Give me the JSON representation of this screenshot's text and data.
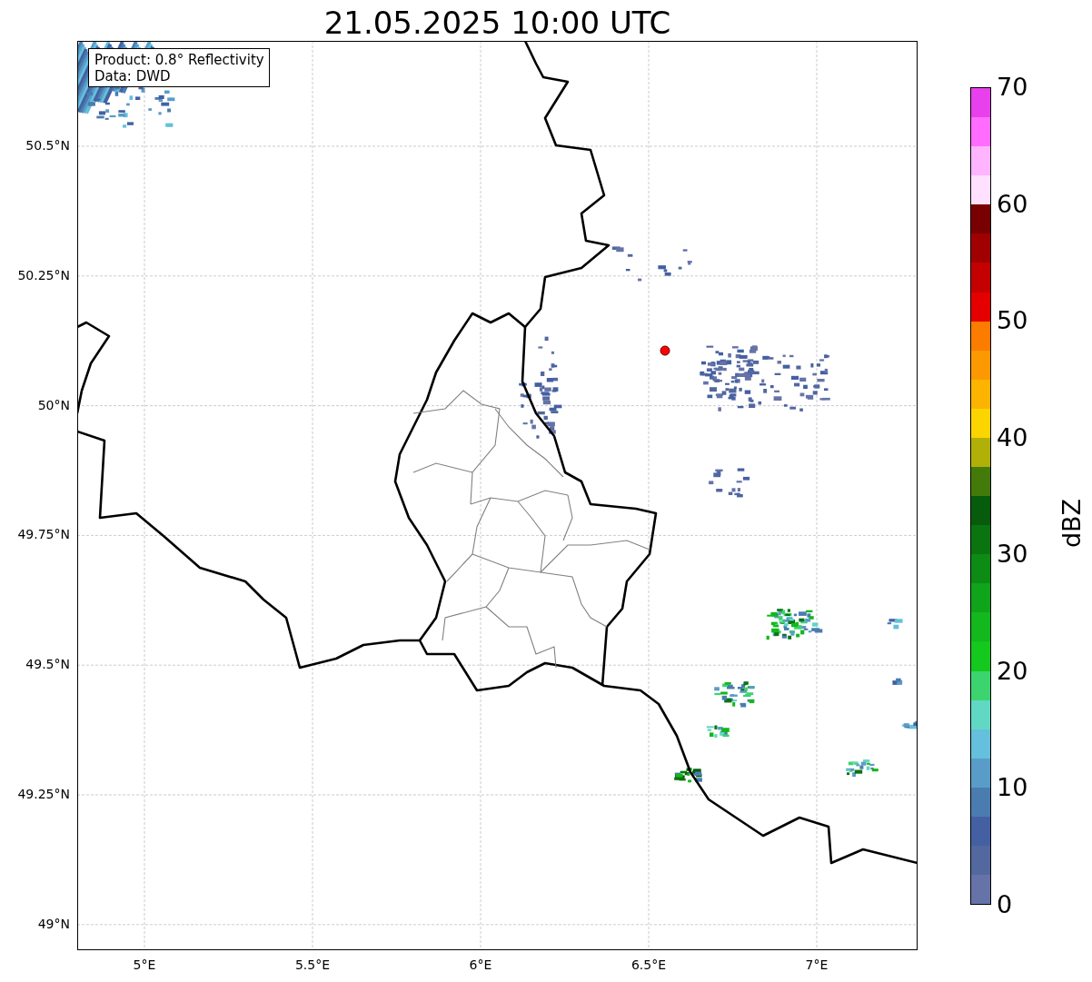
{
  "title": "21.05.2025 10:00 UTC",
  "info_box": {
    "lines": [
      "Product: 0.8° Reflectivity",
      "Data: DWD"
    ]
  },
  "map": {
    "x_ticks": [
      "5°E",
      "5.5°E",
      "6°E",
      "6.5°E",
      "7°E"
    ],
    "y_ticks": [
      "50.5°N",
      "50.25°N",
      "50°N",
      "49.75°N",
      "49.5°N",
      "49.25°N",
      "49°N"
    ]
  },
  "colorbar": {
    "label": "dBZ",
    "ticks": [
      "70",
      "60",
      "50",
      "40",
      "30",
      "20",
      "10",
      "0"
    ],
    "bins": [
      {
        "color": "#e840ec"
      },
      {
        "color": "#ff6cff"
      },
      {
        "color": "#ffb4ff"
      },
      {
        "color": "#ffe0ff"
      },
      {
        "color": "#780000"
      },
      {
        "color": "#a00000"
      },
      {
        "color": "#c40000"
      },
      {
        "color": "#e40000"
      },
      {
        "color": "#fc7c00"
      },
      {
        "color": "#fc9800"
      },
      {
        "color": "#fcb400"
      },
      {
        "color": "#fcd400"
      },
      {
        "color": "#b0b008"
      },
      {
        "color": "#447a0a"
      },
      {
        "color": "#065c0c"
      },
      {
        "color": "#0a7410"
      },
      {
        "color": "#0c8c14"
      },
      {
        "color": "#10a41a"
      },
      {
        "color": "#12b81c"
      },
      {
        "color": "#14c81e"
      },
      {
        "color": "#3cd46e"
      },
      {
        "color": "#60d8c4"
      },
      {
        "color": "#64c0dc"
      },
      {
        "color": "#5a9cc8"
      },
      {
        "color": "#4a7cb0"
      },
      {
        "color": "#4460a2"
      },
      {
        "color": "#52689e"
      },
      {
        "color": "#6673a8"
      }
    ]
  }
}
